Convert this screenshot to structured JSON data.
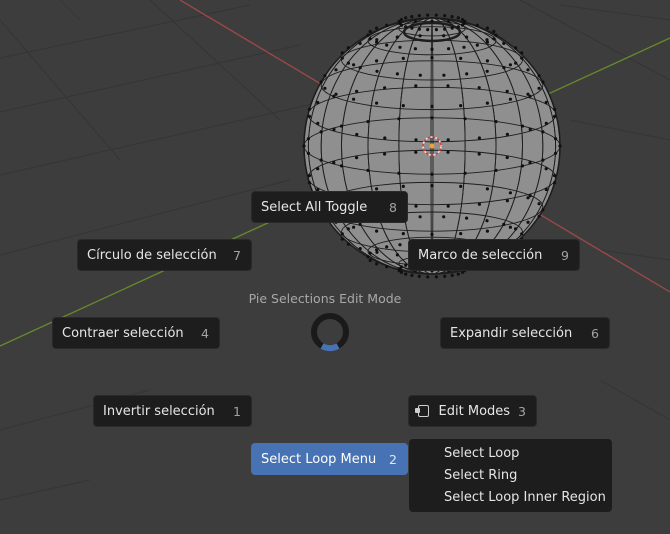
{
  "pie_menu": {
    "title": "Pie Selections Edit Mode",
    "items": [
      {
        "label": "Select All Toggle",
        "key": "8"
      },
      {
        "label": "Círculo de selección",
        "key": "7"
      },
      {
        "label": "Marco de selección",
        "key": "9"
      },
      {
        "label": "Contraer selección",
        "key": "4"
      },
      {
        "label": "Expandir selección",
        "key": "6"
      },
      {
        "label": "Invertir selección",
        "key": "1"
      },
      {
        "label": "Edit Modes",
        "key": "3"
      },
      {
        "label": "Select Loop Menu",
        "key": "2"
      }
    ]
  },
  "submenu": {
    "items": [
      "Select Loop",
      "Select Ring",
      "Select Loop Inner Region"
    ]
  },
  "colors": {
    "viewport_bg": "#3d3d3d",
    "grid": "#363636",
    "x_axis": "#a54a4a",
    "y_axis": "#6c8a2c",
    "highlight": "#4772b3",
    "menu_bg": "#1d1d1d"
  }
}
